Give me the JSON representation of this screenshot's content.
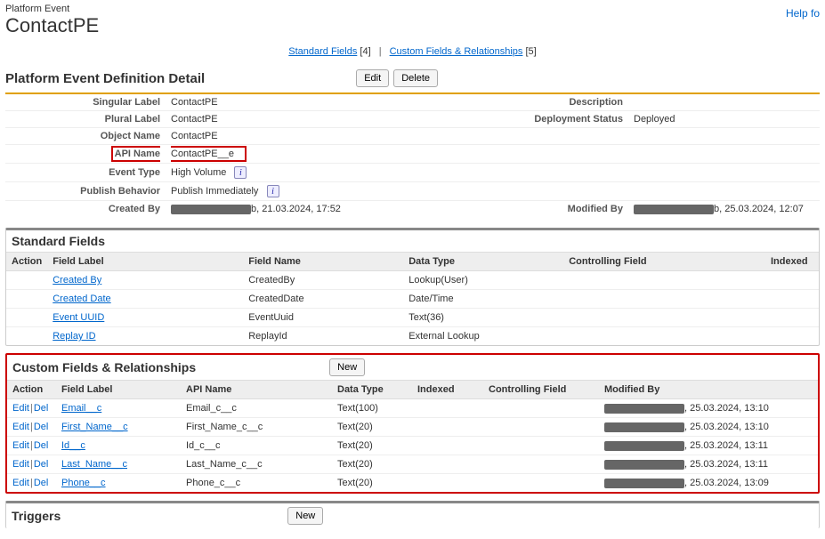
{
  "header": {
    "sup": "Platform Event",
    "title": "ContactPE",
    "help": "Help fo"
  },
  "anchors": {
    "standard": "Standard Fields",
    "standard_count": "[4]",
    "custom": "Custom Fields & Relationships",
    "custom_count": "[5]"
  },
  "detail": {
    "section_title": "Platform Event Definition Detail",
    "edit": "Edit",
    "delete": "Delete",
    "rows": {
      "singular_label_lbl": "Singular Label",
      "singular_label_val": "ContactPE",
      "description_lbl": "Description",
      "description_val": "",
      "plural_label_lbl": "Plural Label",
      "plural_label_val": "ContactPE",
      "deployment_status_lbl": "Deployment Status",
      "deployment_status_val": "Deployed",
      "object_name_lbl": "Object Name",
      "object_name_val": "ContactPE",
      "api_name_lbl": "API Name",
      "api_name_val": "ContactPE__e",
      "event_type_lbl": "Event Type",
      "event_type_val": "High Volume",
      "publish_behavior_lbl": "Publish Behavior",
      "publish_behavior_val": "Publish Immediately",
      "created_by_lbl": "Created By",
      "created_by_suffix": "b, 21.03.2024, 17:52",
      "modified_by_lbl": "Modified By",
      "modified_by_suffix": "b, 25.03.2024, 12:07"
    }
  },
  "standard_fields": {
    "title": "Standard Fields",
    "cols": {
      "action": "Action",
      "field_label": "Field Label",
      "field_name": "Field Name",
      "data_type": "Data Type",
      "controlling_field": "Controlling Field",
      "indexed": "Indexed"
    },
    "rows": [
      {
        "label": "Created By",
        "name": "CreatedBy",
        "type": "Lookup(User)"
      },
      {
        "label": "Created Date",
        "name": "CreatedDate",
        "type": "Date/Time"
      },
      {
        "label": "Event UUID",
        "name": "EventUuid",
        "type": "Text(36)"
      },
      {
        "label": "Replay ID",
        "name": "ReplayId",
        "type": "External Lookup"
      }
    ]
  },
  "custom_fields": {
    "title": "Custom Fields & Relationships",
    "new_btn": "New",
    "cols": {
      "action": "Action",
      "field_label": "Field Label",
      "api_name": "API Name",
      "data_type": "Data Type",
      "indexed": "Indexed",
      "controlling_field": "Controlling Field",
      "modified_by": "Modified By"
    },
    "action_edit": "Edit",
    "action_del": "Del",
    "rows": [
      {
        "label": "Email__c",
        "api": "Email_c__c",
        "type": "Text(100)",
        "mod": ", 25.03.2024, 13:10"
      },
      {
        "label": "First_Name__c",
        "api": "First_Name_c__c",
        "type": "Text(20)",
        "mod": ", 25.03.2024, 13:10"
      },
      {
        "label": "Id__c",
        "api": "Id_c__c",
        "type": "Text(20)",
        "mod": ", 25.03.2024, 13:11"
      },
      {
        "label": "Last_Name__c",
        "api": "Last_Name_c__c",
        "type": "Text(20)",
        "mod": ", 25.03.2024, 13:11"
      },
      {
        "label": "Phone__c",
        "api": "Phone_c__c",
        "type": "Text(20)",
        "mod": ", 25.03.2024, 13:09"
      }
    ]
  },
  "triggers": {
    "title": "Triggers",
    "new_btn": "New"
  }
}
